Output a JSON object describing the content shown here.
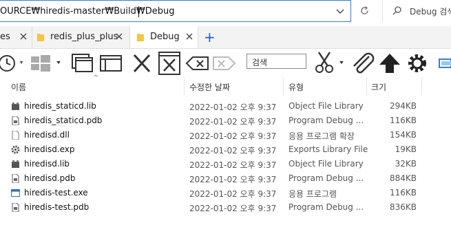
{
  "address": {
    "path": "OURCE₩hiredis-master₩Build₩Debug"
  },
  "search": {
    "placeholder": "Debug 검색"
  },
  "tabs": [
    {
      "label": "es"
    },
    {
      "label": "redis_plus_plus"
    },
    {
      "label": "Debug"
    }
  ],
  "toolbar": {
    "search_box": "검색"
  },
  "columns": {
    "name": "이름",
    "modified": "수정한 날짜",
    "type": "유형",
    "size": "크기"
  },
  "files": [
    {
      "name": "hiredis_staticd.lib",
      "modified": "2022-01-02 오후 9:37",
      "type": "Object File Library",
      "size": "294KB",
      "icon": "library-icon"
    },
    {
      "name": "hiredis_staticd.pdb",
      "modified": "2022-01-02 오후 9:37",
      "type": "Program Debug ...",
      "size": "116KB",
      "icon": "pdb-icon"
    },
    {
      "name": "hiredisd.dll",
      "modified": "2022-01-02 오후 9:37",
      "type": "응용 프로그램 확장",
      "size": "154KB",
      "icon": "dll-icon"
    },
    {
      "name": "hiredisd.exp",
      "modified": "2022-01-02 오후 9:37",
      "type": "Exports Library File",
      "size": "19KB",
      "icon": "exp-icon"
    },
    {
      "name": "hiredisd.lib",
      "modified": "2022-01-02 오후 9:37",
      "type": "Object File Library",
      "size": "32KB",
      "icon": "library-icon"
    },
    {
      "name": "hiredisd.pdb",
      "modified": "2022-01-02 오후 9:37",
      "type": "Program Debug ...",
      "size": "884KB",
      "icon": "pdb-icon"
    },
    {
      "name": "hiredis-test.exe",
      "modified": "2022-01-02 오후 9:37",
      "type": "응용 프로그램",
      "size": "116KB",
      "icon": "exe-icon"
    },
    {
      "name": "hiredis-test.pdb",
      "modified": "2022-01-02 오후 9:37",
      "type": "Program Debug ...",
      "size": "836KB",
      "icon": "pdb-icon"
    }
  ],
  "colors": {
    "accent": "#2f7fd8",
    "tab_bg": "#f3f3f3",
    "folder": "#f4c542"
  }
}
